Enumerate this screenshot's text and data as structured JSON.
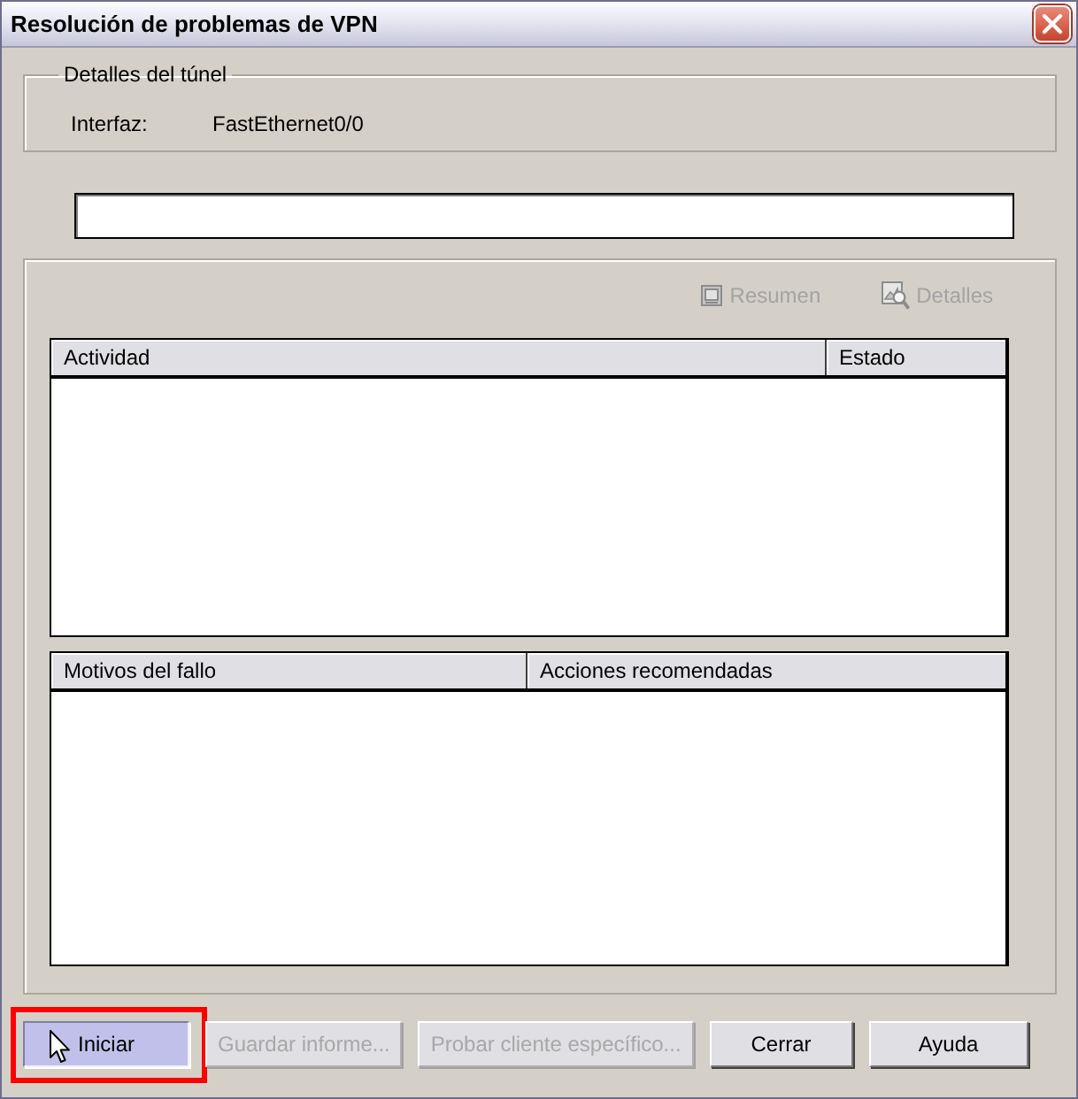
{
  "window": {
    "title": "Resolución de problemas de VPN"
  },
  "tunnel_details": {
    "title": "Detalles del túnel",
    "fields": [
      {
        "label": "Interfaz:",
        "value": "FastEthernet0/0"
      }
    ]
  },
  "view_buttons": [
    {
      "kind": "summary",
      "label": "Resumen",
      "disabled": true
    },
    {
      "kind": "details",
      "label": "Detalles",
      "disabled": true
    }
  ],
  "activity_table": {
    "columns": [
      "Actividad",
      "Estado"
    ]
  },
  "failure_table": {
    "columns": [
      "Motivos del fallo",
      "Acciones recomendadas"
    ]
  },
  "buttons": [
    {
      "label": "Iniciar",
      "disabled": false,
      "pressed": true,
      "highlighted": true
    },
    {
      "label": "Guardar informe...",
      "disabled": true,
      "pressed": false,
      "highlighted": false
    },
    {
      "label": "Probar cliente específico...",
      "disabled": true,
      "pressed": false,
      "highlighted": false
    },
    {
      "label": "Cerrar",
      "disabled": false,
      "pressed": false,
      "highlighted": false
    },
    {
      "label": "Ayuda",
      "disabled": false,
      "pressed": false,
      "highlighted": false
    }
  ]
}
